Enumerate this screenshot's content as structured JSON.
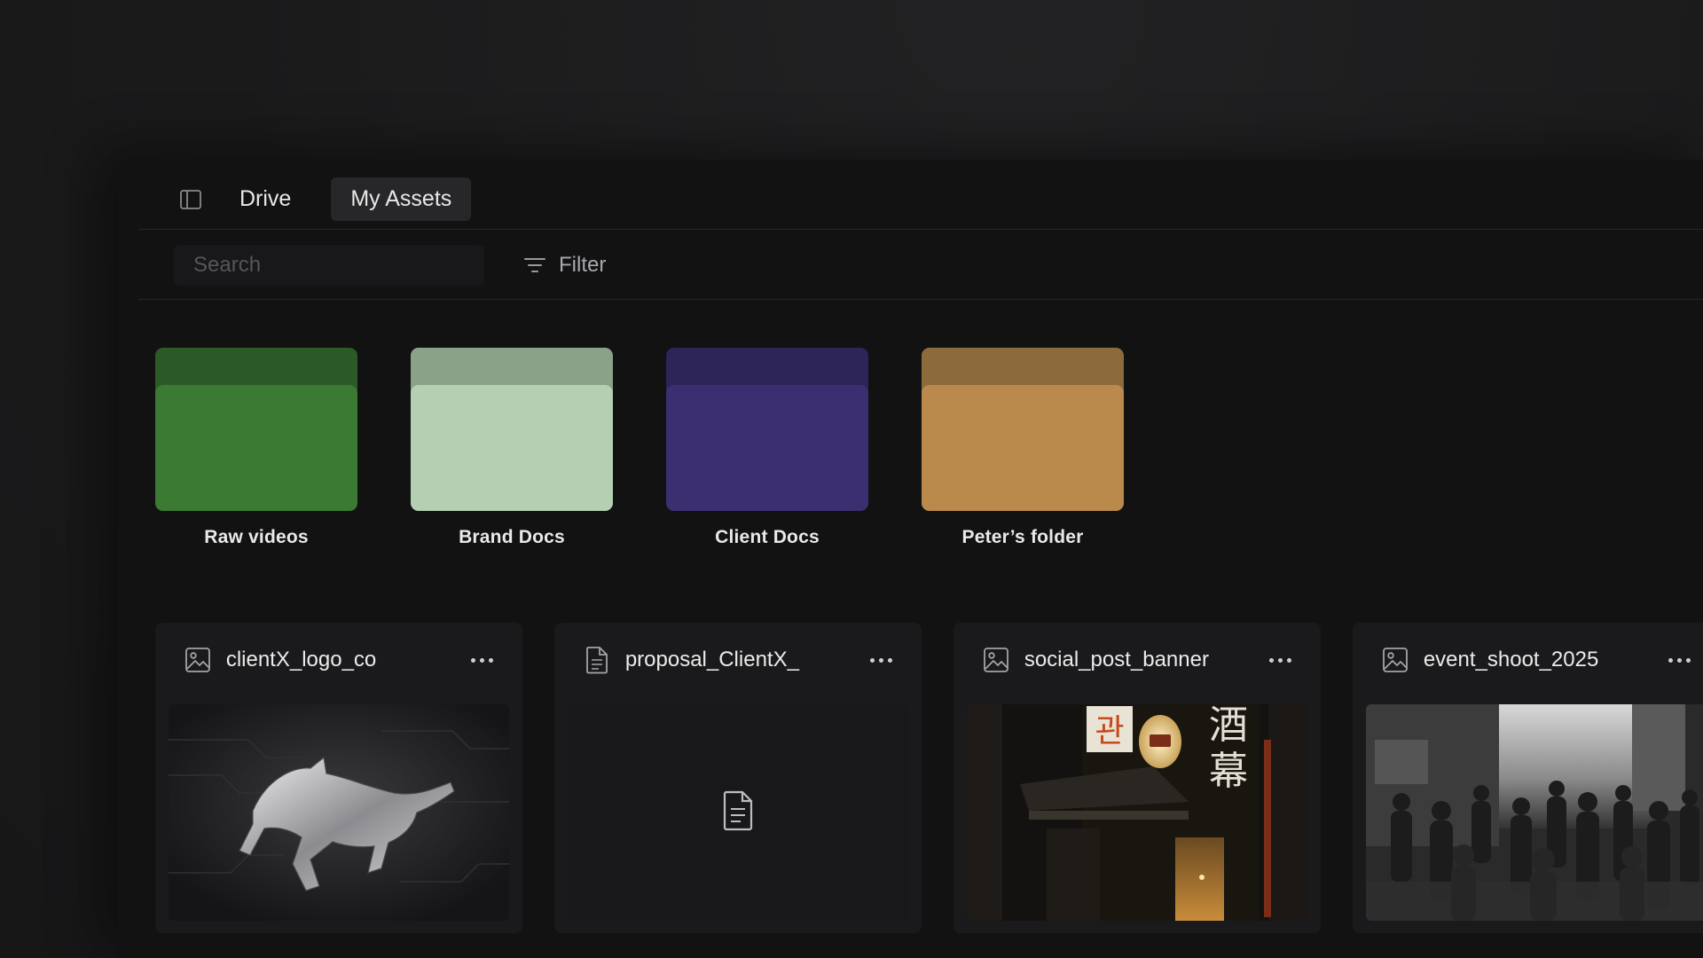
{
  "nav": {
    "tabs": [
      {
        "label": "Drive",
        "active": false
      },
      {
        "label": "My Assets",
        "active": true
      }
    ]
  },
  "search": {
    "placeholder": "Search"
  },
  "filter": {
    "label": "Filter"
  },
  "folders": [
    {
      "label": "Raw videos",
      "color_front": "#3a7a32",
      "color_back": "#2b5a26"
    },
    {
      "label": "Brand Docs",
      "color_front": "#b4cfb1",
      "color_back": "#8aa288"
    },
    {
      "label": "Client Docs",
      "color_front": "#3b2f72",
      "color_back": "#2d2458"
    },
    {
      "label": "Peter’s folder",
      "color_front": "#b98a4c",
      "color_back": "#8d6a3c"
    }
  ],
  "files": [
    {
      "name": "clientX_logo_co",
      "type_icon": "image-icon",
      "thumbnail": "horse-logo"
    },
    {
      "name": "proposal_ClientX_",
      "type_icon": "document-icon",
      "thumbnail": "document-placeholder"
    },
    {
      "name": "social_post_banner",
      "type_icon": "image-icon",
      "thumbnail": "night-street-sign"
    },
    {
      "name": "event_shoot_2025",
      "type_icon": "image-icon",
      "thumbnail": "crowd-photo"
    }
  ],
  "thumb_text": {
    "sign_1": "관",
    "sign_2": "酒",
    "sign_3": "幕"
  }
}
